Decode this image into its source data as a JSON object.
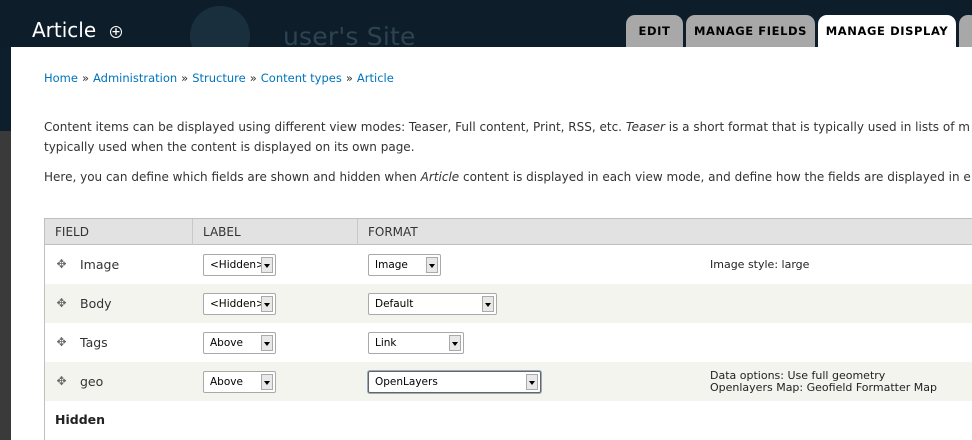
{
  "header": {
    "page_title": "Article",
    "site_name": "user's Site",
    "tabs": [
      {
        "label": "EDIT",
        "active": false
      },
      {
        "label": "MANAGE FIELDS",
        "active": false
      },
      {
        "label": "MANAGE DISPLAY",
        "active": true
      }
    ]
  },
  "breadcrumb": [
    "Home",
    "Administration",
    "Structure",
    "Content types",
    "Article"
  ],
  "breadcrumb_separator": "»",
  "help": {
    "p1_line1_a": "Content items can be displayed using different view modes: Teaser, Full content, Print, RSS, etc. ",
    "p1_line1_em": "Teaser",
    "p1_line1_b": " is a short format that is typically used in lists of m",
    "p1_line2": "typically used when the content is displayed on its own page.",
    "p2_a": "Here, you can define which fields are shown and hidden when ",
    "p2_em": "Article",
    "p2_b": " content is displayed in each view mode, and define how the fields are displayed in e"
  },
  "table": {
    "headers": {
      "field": "FIELD",
      "label": "LABEL",
      "format": "FORMAT"
    },
    "rows": [
      {
        "field": "Image",
        "label": "<Hidden>",
        "format": "Image",
        "summary": [
          "Image style: large"
        ]
      },
      {
        "field": "Body",
        "label": "<Hidden>",
        "format": "Default",
        "summary": []
      },
      {
        "field": "Tags",
        "label": "Above",
        "format": "Link",
        "summary": []
      },
      {
        "field": "geo",
        "label": "Above",
        "format": "OpenLayers",
        "summary": [
          "Data options: Use full geometry",
          "Openlayers Map: Geofield Formatter Map"
        ]
      }
    ],
    "hidden_region_label": "Hidden"
  },
  "icons": {
    "shortcut": "add-shortcut-icon",
    "drag": "drag-handle-icon"
  },
  "colors": {
    "header_bg": "#0d1e2a",
    "tab_inactive": "#a8a8a8",
    "tab_active": "#ffffff",
    "link": "#0074bd",
    "row_even": "#f3f4ee",
    "table_header_bg": "#e2e2e2"
  }
}
